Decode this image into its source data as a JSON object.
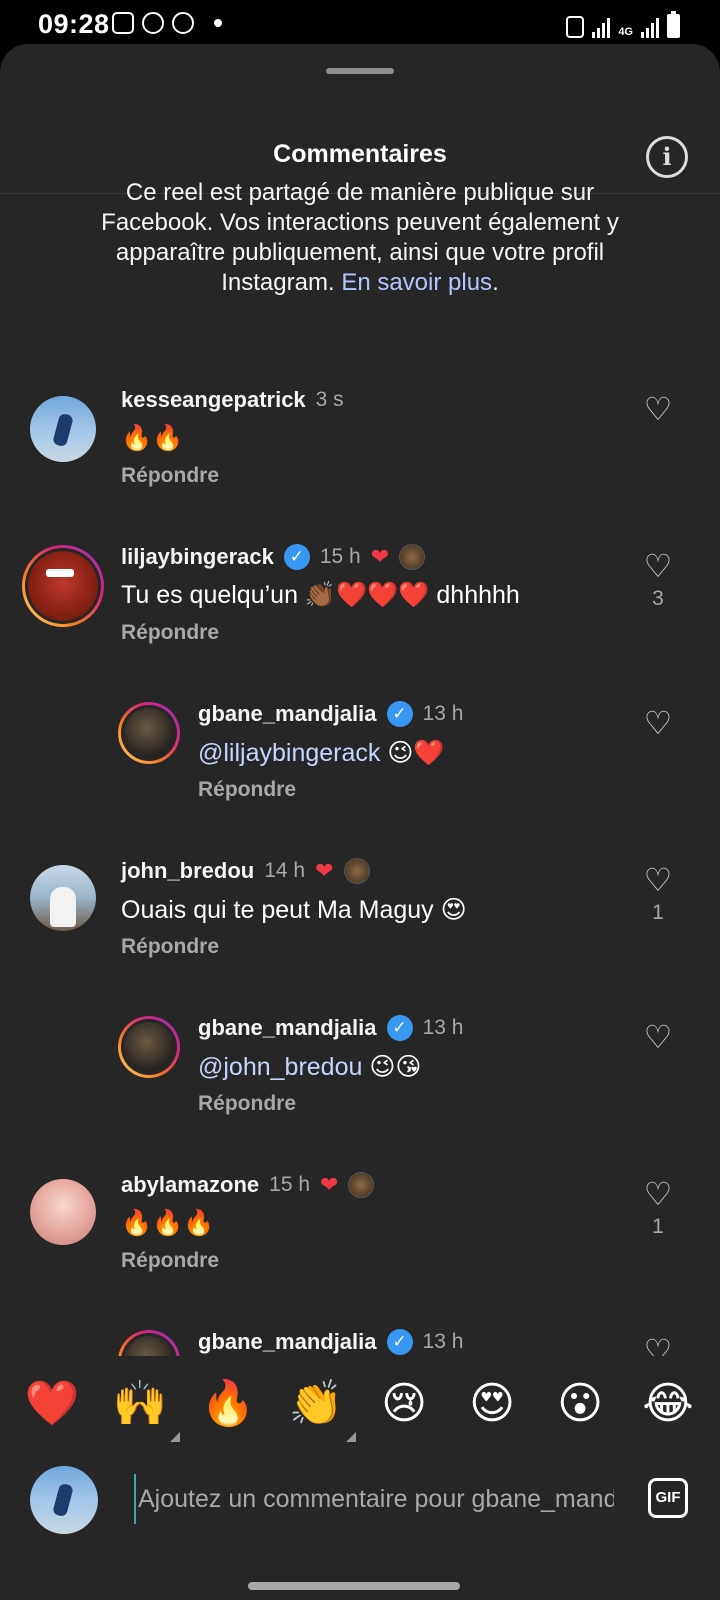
{
  "status_bar": {
    "time": "09:28",
    "network": "4G",
    "icons": [
      "gallery-icon",
      "whatsapp-icon",
      "b-icon",
      "dot-icon",
      "eco-icon",
      "signal-icon",
      "battery-icon"
    ]
  },
  "sheet": {
    "title": "Commentaires",
    "info_icon": "info-icon",
    "notice": {
      "text": "Ce reel est partagé de manière publique sur Facebook. Vos interactions peuvent également y apparaître publiquement, ainsi que votre profil Instagram.",
      "link": "En savoir plus",
      "end": "."
    }
  },
  "comments": [
    {
      "user": "kesseangepatrick",
      "time": "3 s",
      "text": "🔥🔥",
      "reply_label": "Répondre",
      "verified": false,
      "liked_by_author": false,
      "likes": ""
    },
    {
      "user": "liljaybingerack",
      "time": "15 h",
      "text": "Tu es quelqu’un 👏🏾❤️❤️❤️ dhhhhh",
      "reply_label": "Répondre",
      "verified": true,
      "liked_by_author": true,
      "likes": "3"
    },
    {
      "user": "gbane_mandjalia",
      "time": "13 h",
      "mention": "@liljaybingerack",
      "text": " 😉❤️",
      "reply_label": "Répondre",
      "verified": true,
      "liked_by_author": false,
      "likes": ""
    },
    {
      "user": "john_bredou",
      "time": "14 h",
      "text": "Ouais qui te peut Ma Maguy 😍",
      "reply_label": "Répondre",
      "verified": false,
      "liked_by_author": true,
      "likes": "1"
    },
    {
      "user": "gbane_mandjalia",
      "time": "13 h",
      "mention": "@john_bredou",
      "text": " 😉😘",
      "reply_label": "Répondre",
      "verified": true,
      "liked_by_author": false,
      "likes": ""
    },
    {
      "user": "abylamazone",
      "time": "15 h",
      "text": "🔥🔥🔥",
      "reply_label": "Répondre",
      "verified": false,
      "liked_by_author": true,
      "likes": "1"
    },
    {
      "user": "gbane_mandjalia",
      "time": "13 h",
      "verified": true
    }
  ],
  "reactions": [
    "❤️",
    "🙌",
    "🔥",
    "👏",
    "😢",
    "😍",
    "😮",
    "😂"
  ],
  "composer": {
    "placeholder": "Ajoutez un commentaire pour gbane_mandjalia",
    "gif_label": "GIF"
  },
  "colors": {
    "sheet_bg": "#262626",
    "like_red": "#ed3a45",
    "verified_blue": "#3897f0",
    "link_blue": "#b3c7ff",
    "muted_text": "#a8a8a8"
  }
}
